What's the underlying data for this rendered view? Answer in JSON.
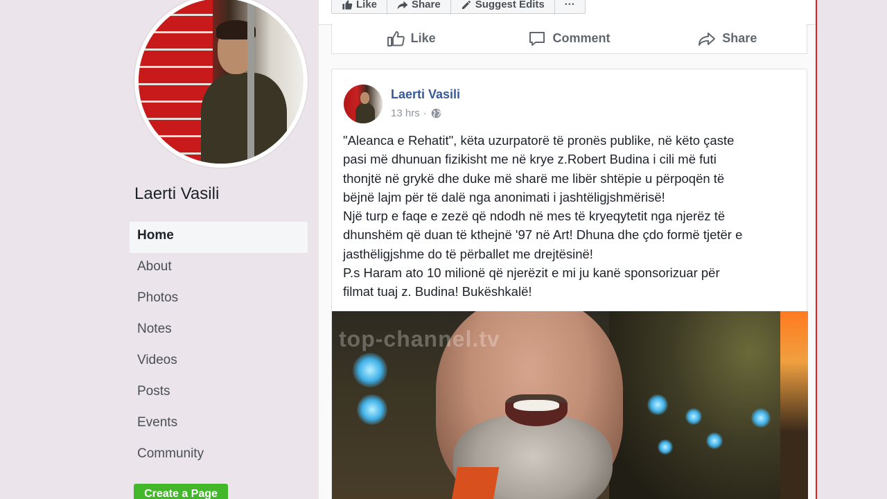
{
  "page": {
    "name": "Laerti Vasili",
    "nav": [
      {
        "label": "Home",
        "active": true
      },
      {
        "label": "About"
      },
      {
        "label": "Photos"
      },
      {
        "label": "Notes"
      },
      {
        "label": "Videos"
      },
      {
        "label": "Posts"
      },
      {
        "label": "Events"
      },
      {
        "label": "Community"
      }
    ],
    "create_page_label": "Create a Page"
  },
  "top_buttons": {
    "like": "Like",
    "share": "Share",
    "suggest_edits": "Suggest Edits",
    "more": "···"
  },
  "action_bar": {
    "like": "Like",
    "comment": "Comment",
    "share": "Share"
  },
  "post": {
    "author": "Laerti Vasili",
    "time": "13 hrs",
    "separator": "·",
    "lines": [
      "\"Aleanca e Rehatit\", këta uzurpatorë të pronës publike, në këto çaste",
      "pasi më dhunuan fizikisht me në krye z.Robert Budina i cili më futi",
      "thonjtë në grykë dhe duke më sharë me libër shtëpie u përpoqën të",
      "bëjnë lajm për të dalë nga anonimati i jashtëligjshmërisë!",
      "Një turp e faqe e zezë që ndodh në mes të kryeqytetit nga njerëz të",
      "dhunshëm që duan të kthejnë '97 në Art! Dhuna dhe çdo formë tjetër e",
      "jasthëligjshme do të përballet me drejtësinë!",
      "P.s Haram ato 10 milionë që njerëzit e mi ju kanë sponsorizuar për",
      "filmat tuaj z. Budina! Bukëshkalë!"
    ],
    "image_watermark": "top-channel.tv"
  },
  "colors": {
    "link": "#385898",
    "create_page": "#42b72a",
    "frame_line": "#e02020"
  }
}
